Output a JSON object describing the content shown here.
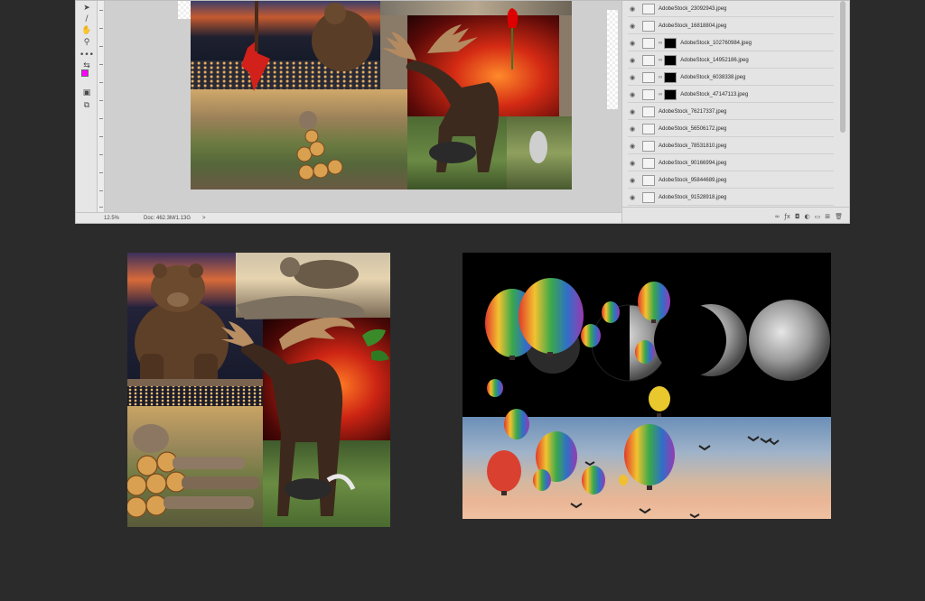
{
  "status_bar": {
    "zoom": "12.5%",
    "doc_info": "Doc: 462.3M/1.13G",
    "arrow": ">"
  },
  "layers": [
    "AdobeStock_23092943.jpeg",
    "AdobeStock_16818804.jpeg",
    "AdobeStock_102760984.jpeg",
    "AdobeStock_14952186.jpeg",
    "AdobeStock_6038338.jpeg",
    "AdobeStock_47147113.jpeg",
    "AdobeStock_76217337.jpeg",
    "AdobeStock_56506172.jpeg",
    "AdobeStock_78531810.jpeg",
    "AdobeStock_90166994.jpeg",
    "AdobeStock_95844689.jpeg",
    "AdobeStock_91528918.jpeg"
  ],
  "icons": {
    "eye": "eye-icon",
    "chain": "link-icon",
    "footer": [
      "link-icon",
      "fx-icon",
      "mask-icon",
      "adjustment-icon",
      "group-icon",
      "new-layer-icon",
      "trash-icon"
    ]
  },
  "colors": {
    "app_background": "#2b2b2b",
    "foreground_swatch": "#ff00ff"
  }
}
